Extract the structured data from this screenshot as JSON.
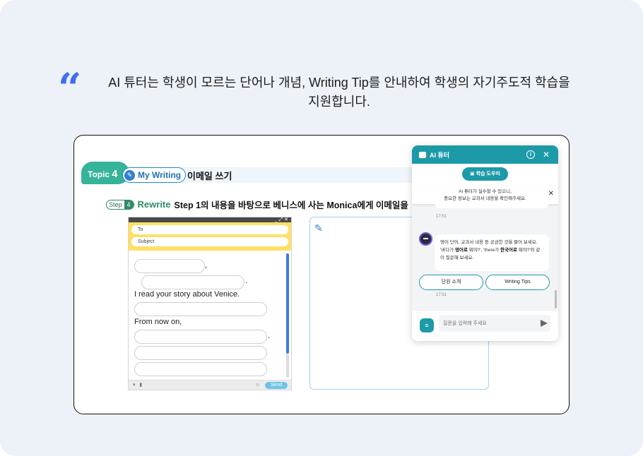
{
  "headline": {
    "quote": "“",
    "line1": "AI 튜터는 학생이 모르는 단어나 개념, Writing Tip를 안내하여 학생의 자기주도적 학습을",
    "line2": "지원합니다."
  },
  "lesson": {
    "topic_label": "Topic",
    "topic_number": "4",
    "section_label": "My Writing",
    "topic_title": "이메일 쓰기",
    "step_label": "Step",
    "step_number": "4",
    "step_name": "Rewrite",
    "step_instruction": "Step 1의 내용을 바탕으로 베니스에 사는 Monica에게 이메일을"
  },
  "email": {
    "window_controls": "_ ⤢ ✕",
    "to_placeholder": "To",
    "subject_placeholder": "Subject",
    "line_read": "I read your story about Venice.",
    "line_from": "From now on,",
    "send_label": "Send"
  },
  "chat": {
    "title": "AI 튜터",
    "study_helper": "학습 도우미",
    "notice_line1": "AI 튜터가 실수할 수 있으니,",
    "notice_line2": "중요한 정보는 교과서 내용을 확인해주세요.",
    "time1": "17:51",
    "message_part1": "영어 단어, 교과서 내용 등 궁금한 것을 물어 보세요. '바다가 ",
    "message_bold1": "영어로",
    "message_part2": " 뭐야?', 'there가 ",
    "message_bold2": "한국어로",
    "message_part3": " 뭐야?'와 같이 질문해 보세요.",
    "quick_reply_1": "단원 소개",
    "quick_reply_2": "Writing Tips",
    "time2": "17:51",
    "input_placeholder": "질문을 입력해 주세요"
  },
  "colors": {
    "accent_blue": "#3f6ef0",
    "teal": "#1d9aa8",
    "topic_green": "#35b39b",
    "email_header_yellow": "#ffe066"
  }
}
